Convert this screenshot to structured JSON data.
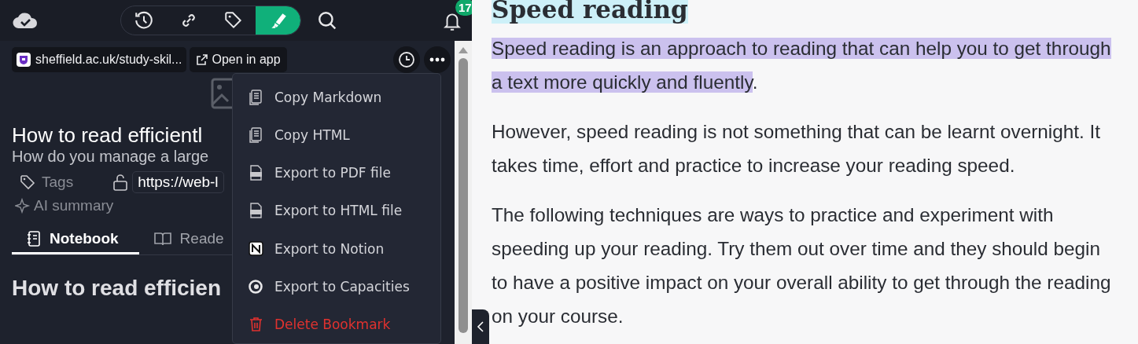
{
  "toolbar": {
    "tools": [
      {
        "kind": "history",
        "selected": false
      },
      {
        "kind": "link",
        "selected": false
      },
      {
        "kind": "tag",
        "selected": false
      },
      {
        "kind": "highlight",
        "selected": true
      }
    ],
    "notification_count": "17"
  },
  "bookmark": {
    "source": "sheffield.ac.uk/study-skil...",
    "open_button": "Open in app",
    "title": "How to read efficientl",
    "subtitle": "How do you manage a large",
    "tags_label": "Tags",
    "url": "https://web-l",
    "ai_summary": "AI summary"
  },
  "tabs": [
    {
      "label": "Notebook",
      "selected": true
    },
    {
      "label": "Reade",
      "selected": false
    }
  ],
  "notebook_heading": "How to read efficien",
  "menu": [
    {
      "label": "Copy Markdown",
      "kind": "copy"
    },
    {
      "label": "Copy HTML",
      "kind": "copy"
    },
    {
      "label": "Export to PDF file",
      "kind": "pdf"
    },
    {
      "label": "Export to HTML file",
      "kind": "html"
    },
    {
      "label": "Export to Notion",
      "kind": "notion"
    },
    {
      "label": "Export to Capacities",
      "kind": "capacities"
    },
    {
      "label": "Delete Bookmark",
      "kind": "delete"
    }
  ],
  "reader": {
    "heading": "Speed reading",
    "heading_highlighted": true,
    "paragraphs": [
      [
        {
          "text": "Speed reading is an approach to reading that can help you to get through a text more quickly and fluently",
          "highlighted": true
        },
        {
          "text": ".",
          "highlighted": false
        }
      ],
      [
        {
          "text": "However, speed reading is not something that can be learnt overnight. It takes time, effort and practice to increase your reading speed.",
          "highlighted": false
        }
      ],
      [
        {
          "text": "The following techniques are ways to practice and experiment with speeding up your reading. Try them out over time and they should begin to have a positive impact on your overall ability to get through the reading on your course.",
          "highlighted": false
        }
      ]
    ]
  }
}
